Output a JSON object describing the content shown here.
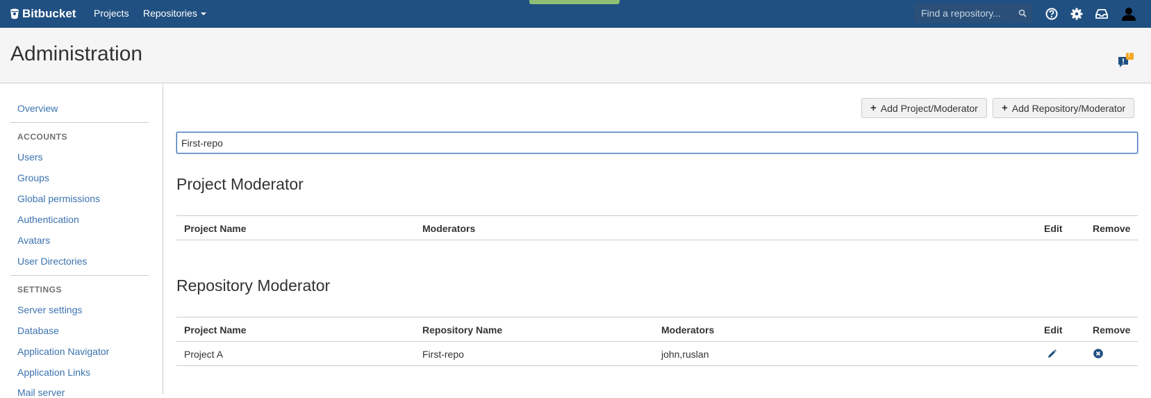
{
  "topbar": {
    "brand": "Bitbucket",
    "projects": "Projects",
    "repositories": "Repositories",
    "search_placeholder": "Find a repository...",
    "icons": [
      "help-icon",
      "gear-icon",
      "inbox-icon",
      "user-icon"
    ]
  },
  "header": {
    "title": "Administration",
    "feedback_badge": "!"
  },
  "sidebar": {
    "overview": "Overview",
    "accounts_heading": "ACCOUNTS",
    "accounts": [
      "Users",
      "Groups",
      "Global permissions",
      "Authentication",
      "Avatars",
      "User Directories"
    ],
    "settings_heading": "SETTINGS",
    "settings": [
      "Server settings",
      "Database",
      "Application Navigator",
      "Application Links",
      "Mail server"
    ]
  },
  "toolbar": {
    "add_project": "Add Project/Moderator",
    "add_repository": "Add Repository/Moderator"
  },
  "filter": {
    "value": "First-repo"
  },
  "project_section": {
    "title": "Project Moderator",
    "columns": [
      "Project Name",
      "Moderators",
      "Edit",
      "Remove"
    ],
    "rows": []
  },
  "repo_section": {
    "title": "Repository Moderator",
    "columns": [
      "Project Name",
      "Repository Name",
      "Moderators",
      "Edit",
      "Remove"
    ],
    "rows": [
      {
        "project": "Project A",
        "repository": "First-repo",
        "moderators": "john,ruslan"
      }
    ]
  },
  "colors": {
    "nav": "#205081",
    "link": "#3b73af",
    "badge": "#f5a623"
  }
}
